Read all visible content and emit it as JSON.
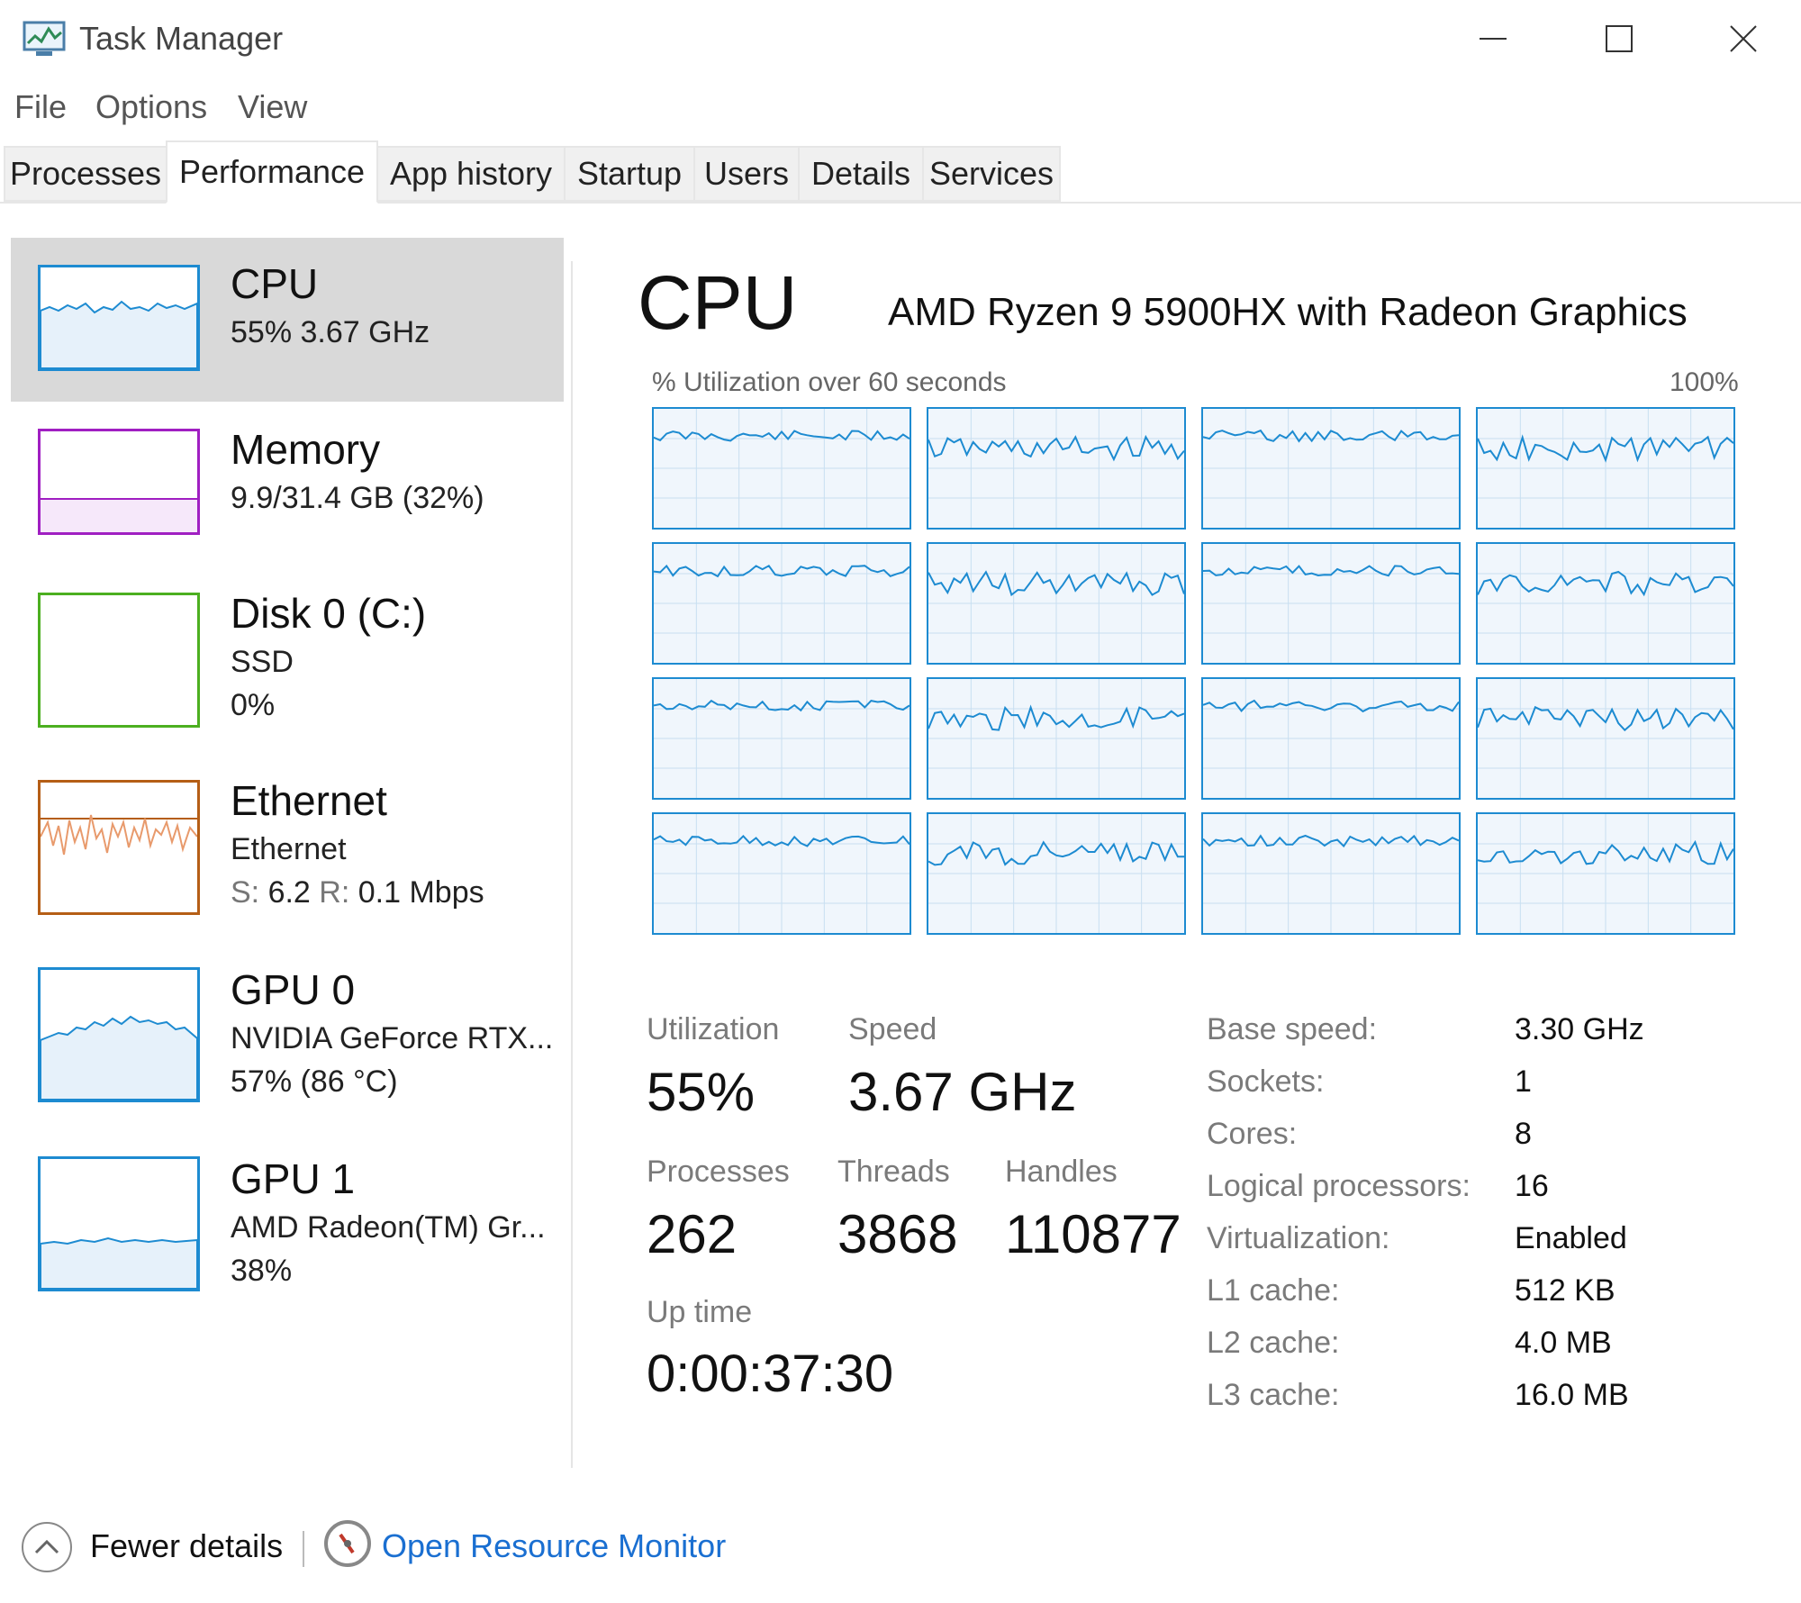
{
  "window": {
    "title": "Task Manager"
  },
  "menu": {
    "file": "File",
    "options": "Options",
    "view": "View"
  },
  "tabs": [
    {
      "label": "Processes"
    },
    {
      "label": "Performance"
    },
    {
      "label": "App history"
    },
    {
      "label": "Startup"
    },
    {
      "label": "Users"
    },
    {
      "label": "Details"
    },
    {
      "label": "Services"
    }
  ],
  "active_tab": "Performance",
  "resources": [
    {
      "name": "CPU",
      "line1": "55%  3.67 GHz",
      "color": "#1d8bd1"
    },
    {
      "name": "Memory",
      "line1": "9.9/31.4 GB (32%)",
      "color": "#a01fc2",
      "fill_fraction": 0.32
    },
    {
      "name": "Disk 0 (C:)",
      "line1": "SSD",
      "line2": "0%",
      "color": "#4caf20"
    },
    {
      "name": "Ethernet",
      "line1": "Ethernet",
      "send_label": "S:",
      "send_value": "6.2",
      "recv_label": "R:",
      "recv_value": "0.1 Mbps",
      "color": "#b55e16"
    },
    {
      "name": "GPU 0",
      "line1": "NVIDIA GeForce RTX...",
      "line2": "57%  (86 °C)",
      "color": "#1d8bd1"
    },
    {
      "name": "GPU 1",
      "line1": "AMD Radeon(TM) Gr...",
      "line2": "38%",
      "color": "#1d8bd1"
    }
  ],
  "cpu": {
    "title": "CPU",
    "model": "AMD Ryzen 9 5900HX with Radeon Graphics",
    "graph_label": "% Utilization over 60 seconds",
    "graph_max": "100%",
    "logical_graph_count": 16,
    "stats": {
      "utilization": {
        "label": "Utilization",
        "value": "55%"
      },
      "speed": {
        "label": "Speed",
        "value": "3.67 GHz"
      },
      "processes": {
        "label": "Processes",
        "value": "262"
      },
      "threads": {
        "label": "Threads",
        "value": "3868"
      },
      "handles": {
        "label": "Handles",
        "value": "110877"
      },
      "uptime": {
        "label": "Up time",
        "value": "0:00:37:30"
      }
    },
    "specs": [
      {
        "label": "Base speed:",
        "value": "3.30 GHz"
      },
      {
        "label": "Sockets:",
        "value": "1"
      },
      {
        "label": "Cores:",
        "value": "8"
      },
      {
        "label": "Logical processors:",
        "value": "16"
      },
      {
        "label": "Virtualization:",
        "value": "Enabled"
      },
      {
        "label": "L1 cache:",
        "value": "512 KB"
      },
      {
        "label": "L2 cache:",
        "value": "4.0 MB"
      },
      {
        "label": "L3 cache:",
        "value": "16.0 MB"
      }
    ]
  },
  "footer": {
    "fewer_details": "Fewer details",
    "open_resource_monitor": "Open Resource Monitor"
  },
  "icons": {
    "app": "task-manager-icon",
    "minimize": "minimize-icon",
    "maximize": "maximize-icon",
    "close": "close-icon",
    "fewer": "chevron-up-icon",
    "resmon": "resource-monitor-icon"
  }
}
